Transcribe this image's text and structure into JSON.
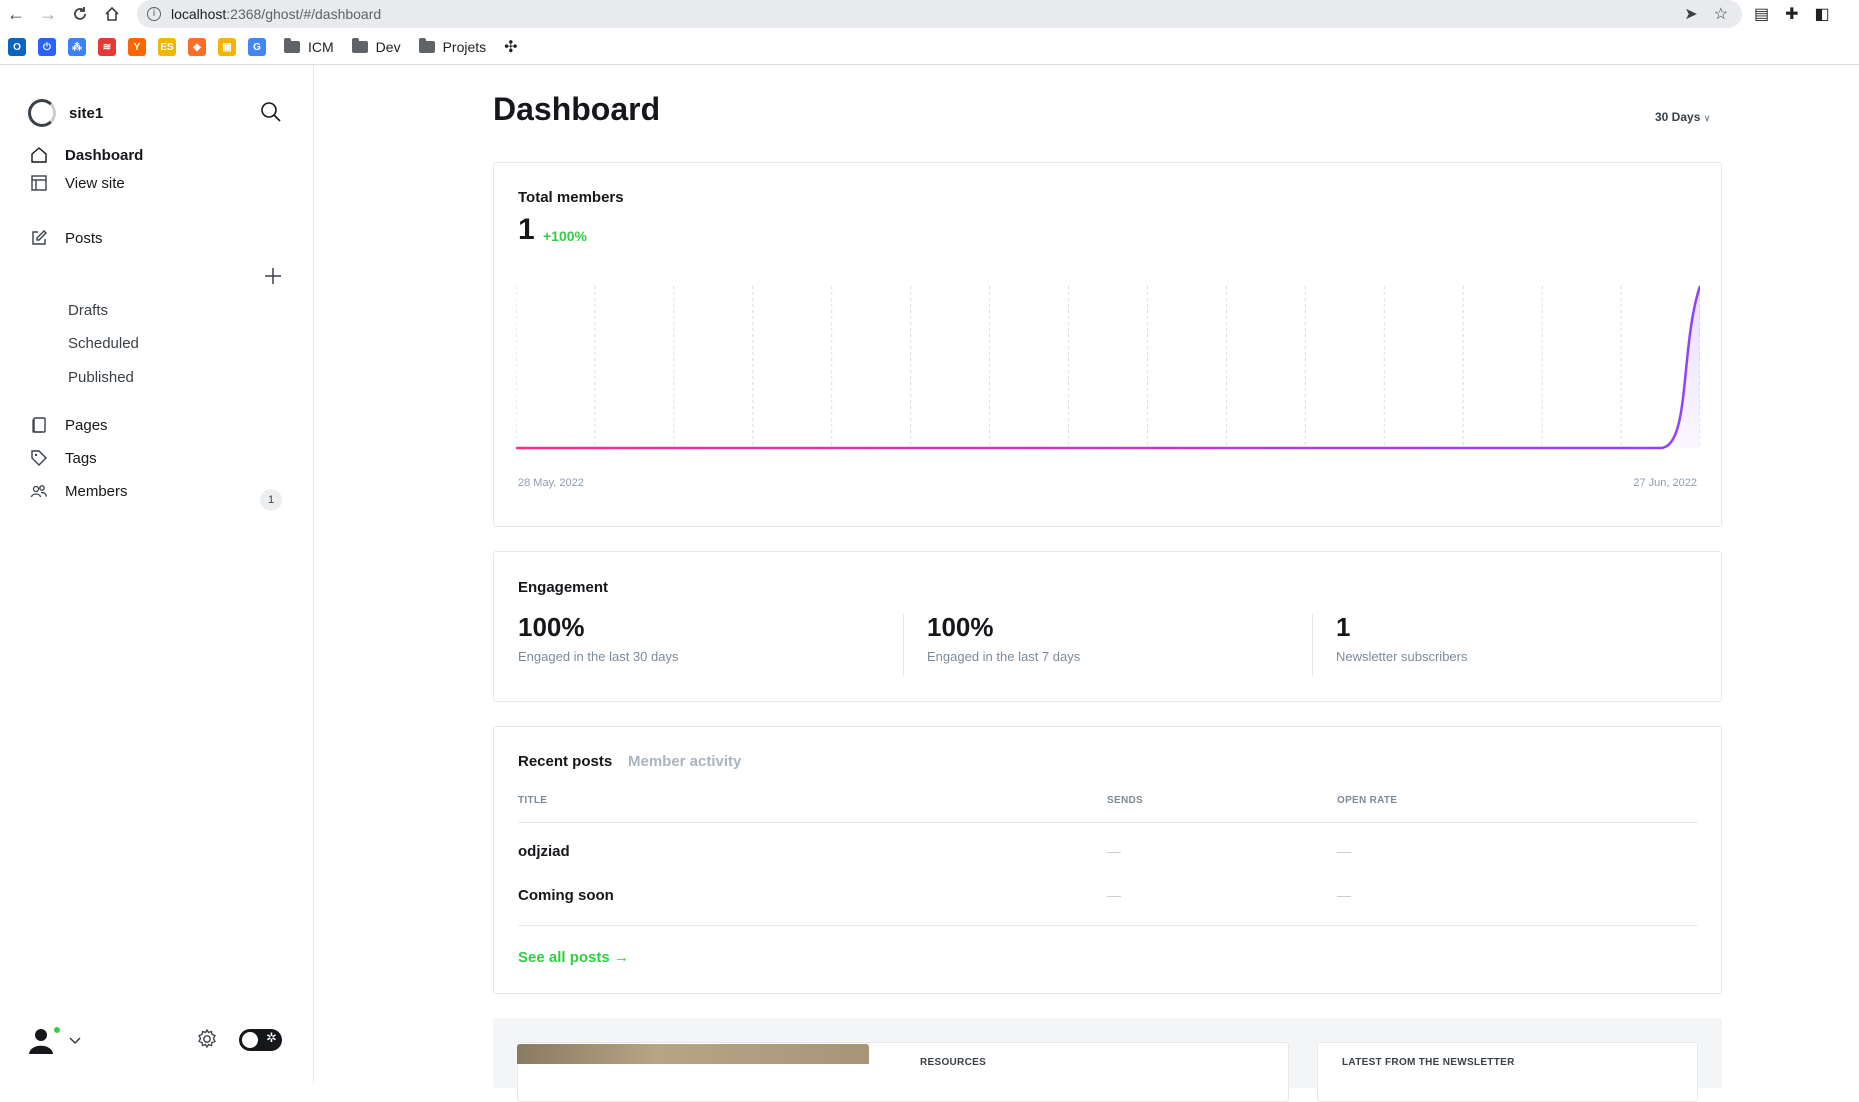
{
  "browser": {
    "url_host": "localhost",
    "url_path": ":2368/ghost/#/dashboard",
    "bookmarks": [
      {
        "icon": "outlook-icon",
        "color": "#0a64c2",
        "glyph": "O"
      },
      {
        "icon": "power-icon",
        "color": "#2962ff",
        "glyph": "⏻"
      },
      {
        "icon": "nodes-icon",
        "color": "#3b82f6",
        "glyph": "⁂"
      },
      {
        "icon": "chart-icon",
        "color": "#e53935",
        "glyph": "≋"
      },
      {
        "icon": "y-icon",
        "color": "#ff6600",
        "glyph": "Y"
      },
      {
        "icon": "es-icon",
        "color": "#f2b600",
        "glyph": "ES"
      },
      {
        "icon": "gitlab-icon",
        "color": "#fc6d26",
        "glyph": "◆"
      },
      {
        "icon": "package-icon",
        "color": "#f5b400",
        "glyph": "▣"
      },
      {
        "icon": "translate-icon",
        "color": "#4285f4",
        "glyph": "G"
      }
    ],
    "folders": [
      "ICM",
      "Dev",
      "Projets"
    ]
  },
  "sidebar": {
    "site_name": "site1",
    "nav": {
      "dashboard": "Dashboard",
      "view_site": "View site",
      "posts": "Posts",
      "drafts": "Drafts",
      "scheduled": "Scheduled",
      "published": "Published",
      "pages": "Pages",
      "tags": "Tags",
      "members": "Members",
      "members_count": "1"
    }
  },
  "header": {
    "title": "Dashboard",
    "range": "30 Days"
  },
  "members_card": {
    "title": "Total members",
    "value": "1",
    "delta": "+100%",
    "date_start": "28 May, 2022",
    "date_end": "27 Jun, 2022"
  },
  "chart_data": {
    "type": "area",
    "x_start": "28 May, 2022",
    "x_end": "27 Jun, 2022",
    "values": [
      0,
      0,
      0,
      0,
      0,
      0,
      0,
      0,
      0,
      0,
      0,
      0,
      0,
      0,
      0,
      0,
      0,
      0,
      0,
      0,
      0,
      0,
      0,
      0,
      0,
      0,
      0,
      0,
      0,
      0,
      1
    ],
    "ylim": [
      0,
      1
    ],
    "grid": "vertical dashed",
    "line_gradient": [
      "#fb2d8d",
      "#8e42ff"
    ]
  },
  "engagement": {
    "title": "Engagement",
    "metrics": [
      {
        "value": "100%",
        "label": "Engaged in the last 30 days"
      },
      {
        "value": "100%",
        "label": "Engaged in the last 7 days"
      },
      {
        "value": "1",
        "label": "Newsletter subscribers"
      }
    ]
  },
  "recent_posts": {
    "tabs": [
      "Recent posts",
      "Member activity"
    ],
    "columns": [
      "TITLE",
      "SENDS",
      "OPEN RATE"
    ],
    "rows": [
      {
        "title": "odjziad",
        "sends": "—",
        "open_rate": "—"
      },
      {
        "title": "Coming soon",
        "sends": "—",
        "open_rate": "—"
      }
    ],
    "see_all": "See all posts →"
  },
  "resources": {
    "resources_label": "RESOURCES",
    "newsletter_label": "LATEST FROM THE NEWSLETTER"
  }
}
